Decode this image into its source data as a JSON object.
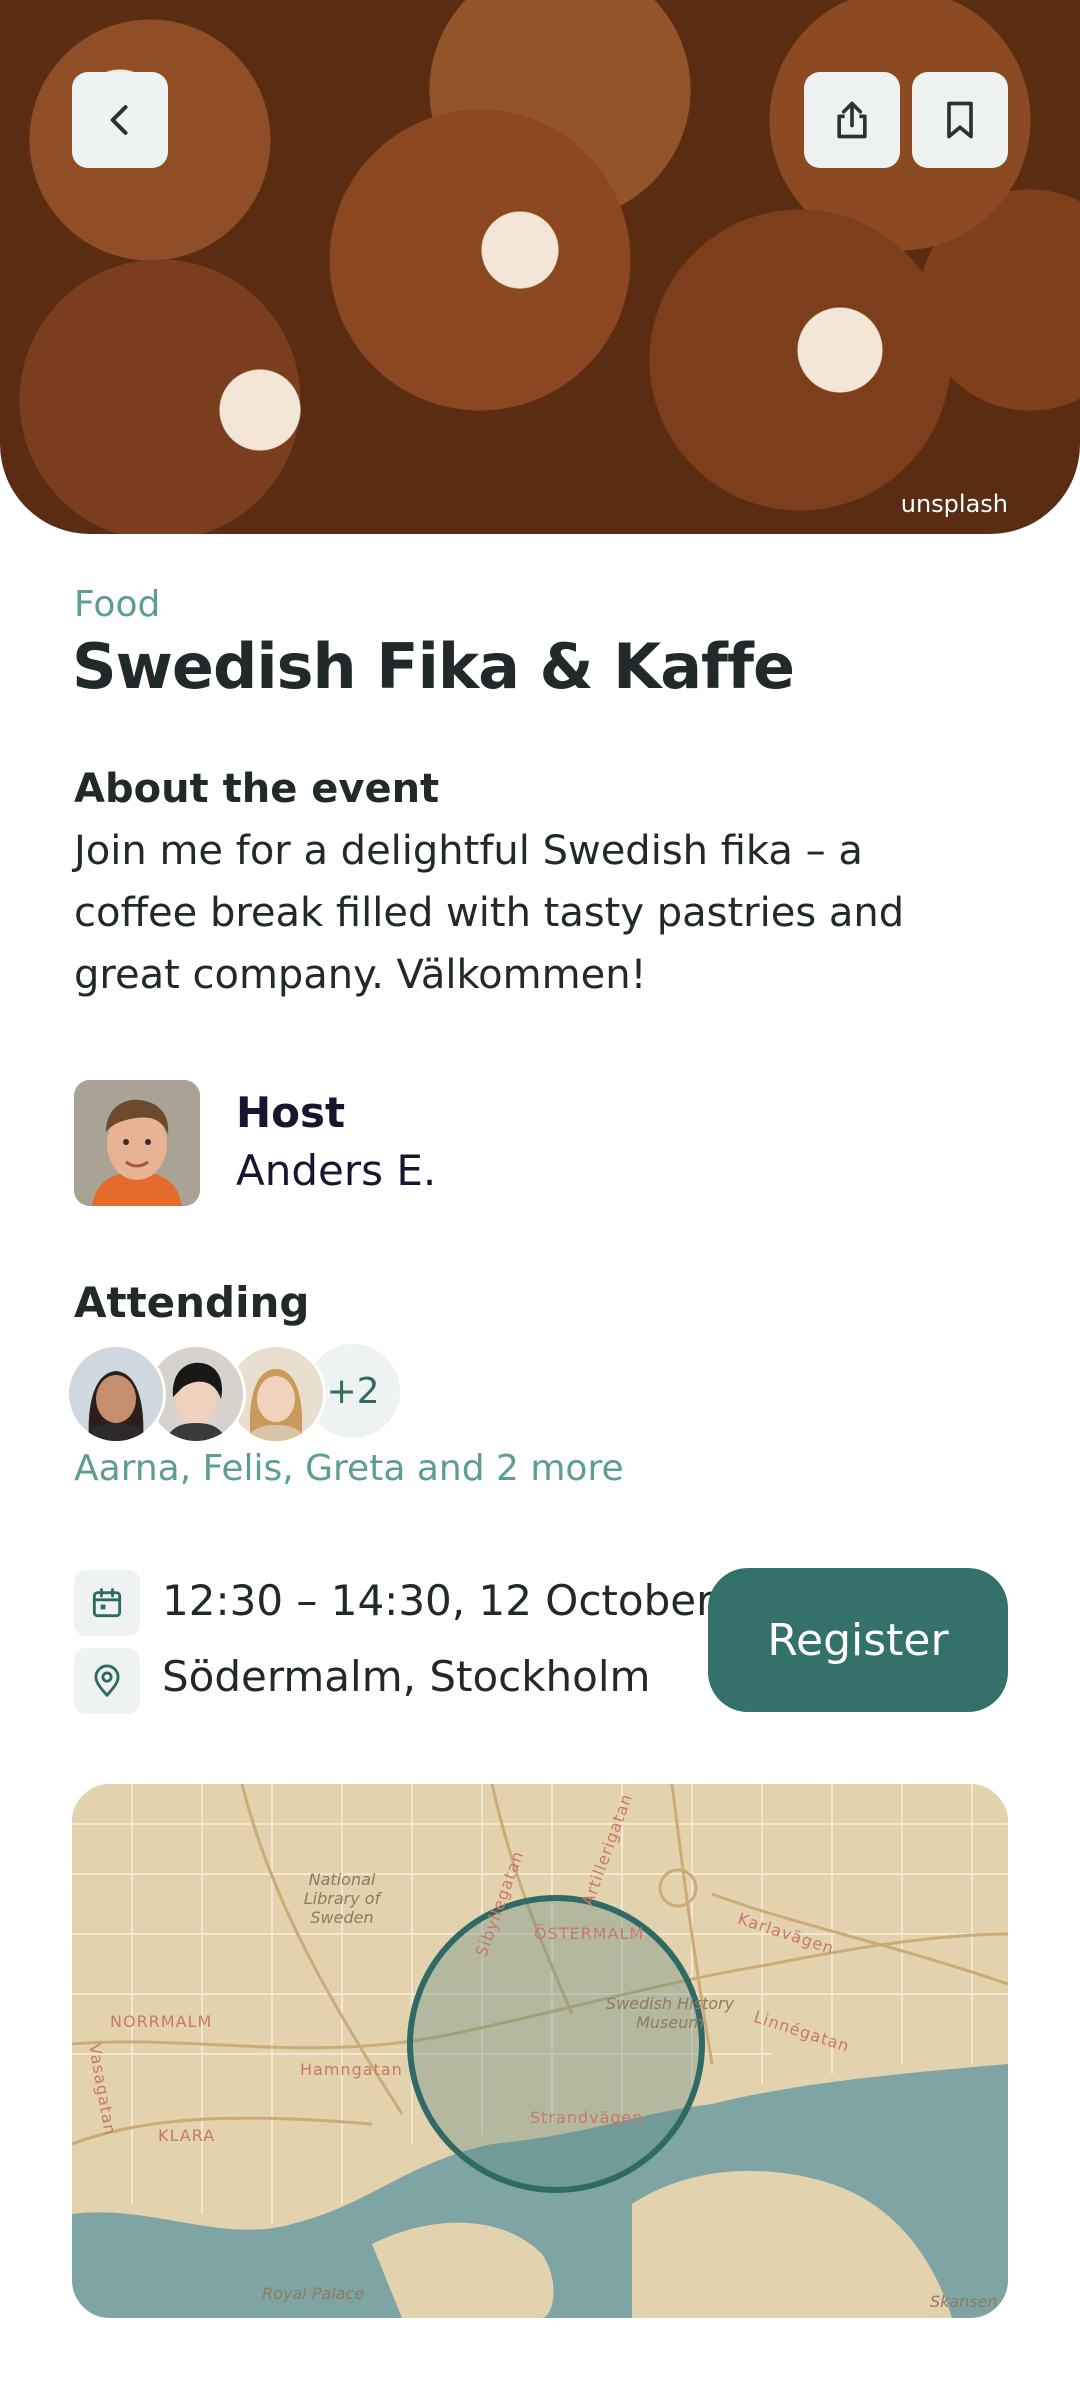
{
  "hero": {
    "credit": "unsplash",
    "back_icon": "chevron-left-icon",
    "share_icon": "share-icon",
    "bookmark_icon": "bookmark-icon"
  },
  "event": {
    "category": "Food",
    "title": "Swedish Fika & Kaffe",
    "about_heading": "About the event",
    "about_text": "Join me for a delightful Swedish fika – a coffee break filled with tasty pastries and great company. Välkommen!"
  },
  "host": {
    "label": "Host",
    "name": "Anders E."
  },
  "attending": {
    "heading": "Attending",
    "more_badge": "+2",
    "summary": "Aarna, Felis, Greta and 2 more"
  },
  "details": {
    "time": "12:30 – 14:30, 12 October",
    "location": "Södermalm, Stockholm",
    "calendar_icon": "calendar-icon",
    "location_icon": "location-pin-icon",
    "register_label": "Register"
  },
  "map": {
    "labels": {
      "library": "National Library of Sweden",
      "ostermalm": "ÖSTERMALM",
      "norrmalm": "NORRMALM",
      "klara": "KLARA",
      "karlavagen": "Karlavägen",
      "linnegatan": "Linnégatan",
      "museum": "Swedish History Museum",
      "hamngatan": "Hamngatan",
      "strandvagen": "Strandvägen",
      "sibyllegatan": "Sibyllegatan",
      "artillerigatan": "Artillerigatan",
      "vasagatan": "Vasagatan",
      "royal_palace": "Royal Palace",
      "skansen": "Skansen"
    }
  },
  "colors": {
    "accent": "#33716a",
    "muted_accent": "#5e9c96",
    "chip_bg": "#eef3f1",
    "map_land": "#e2d2ae",
    "map_water": "#7fa4a4"
  }
}
